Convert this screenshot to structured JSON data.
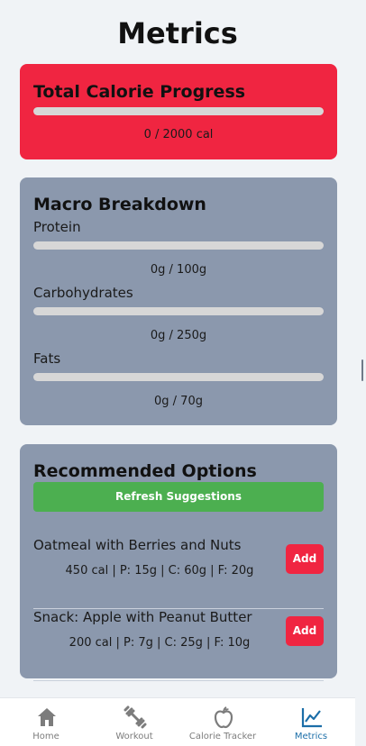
{
  "page": {
    "title": "Metrics"
  },
  "calorie": {
    "title": "Total Calorie Progress",
    "text": "0 / 2000 cal",
    "progress": 0
  },
  "macros": {
    "title": "Macro Breakdown",
    "items": [
      {
        "label": "Protein",
        "text": "0g / 100g",
        "progress": 0
      },
      {
        "label": "Carbohydrates",
        "text": "0g / 250g",
        "progress": 0
      },
      {
        "label": "Fats",
        "text": "0g / 70g",
        "progress": 0
      }
    ]
  },
  "recommended": {
    "title": "Recommended Options",
    "refresh_label": "Refresh Suggestions",
    "items": [
      {
        "name": "Oatmeal with Berries and Nuts",
        "info": "450 cal | P: 15g | C: 60g | F: 20g",
        "add_label": "Add"
      },
      {
        "name": "Snack: Apple with Peanut Butter",
        "info": "200 cal | P: 7g | C: 25g | F: 10g",
        "add_label": "Add"
      }
    ]
  },
  "nav": {
    "items": [
      {
        "label": "Home",
        "icon": "home-icon"
      },
      {
        "label": "Workout",
        "icon": "dumbbell-icon"
      },
      {
        "label": "Calorie Tracker",
        "icon": "apple-icon"
      },
      {
        "label": "Metrics",
        "icon": "chart-icon"
      }
    ],
    "active_index": 3
  },
  "colors": {
    "accent_red": "#f02541",
    "card_gray": "#8b98ad",
    "green": "#4caf50",
    "nav_active": "#1b6ea8"
  }
}
